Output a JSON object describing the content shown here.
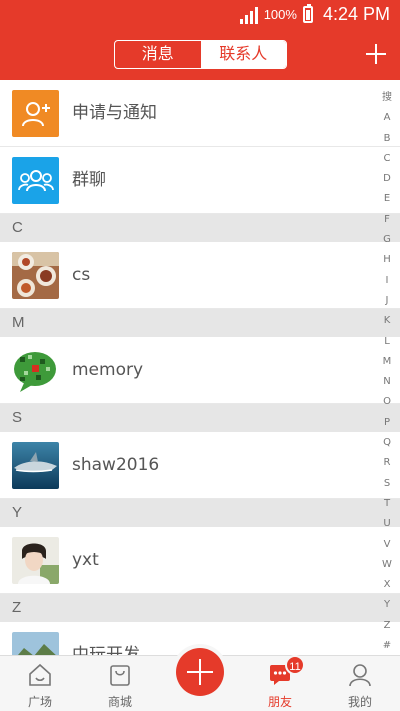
{
  "status_bar": {
    "battery_percent": "100%",
    "time": "4:24 PM"
  },
  "header": {
    "tabs": [
      {
        "label": "消息",
        "active": false
      },
      {
        "label": "联系人",
        "active": true
      }
    ],
    "add_icon": "plus-icon"
  },
  "contacts": {
    "special": [
      {
        "label": "申请与通知",
        "icon": "add-user-icon",
        "color": "#f08a24"
      },
      {
        "label": "群聊",
        "icon": "group-icon",
        "color": "#1aa3e8"
      }
    ],
    "sections": [
      {
        "letter": "C",
        "items": [
          {
            "name": "cs"
          }
        ]
      },
      {
        "letter": "M",
        "items": [
          {
            "name": "memory"
          }
        ]
      },
      {
        "letter": "S",
        "items": [
          {
            "name": "shaw2016"
          }
        ]
      },
      {
        "letter": "Y",
        "items": [
          {
            "name": "yxt"
          }
        ]
      },
      {
        "letter": "Z",
        "items": [
          {
            "name": "中玩开发"
          }
        ]
      }
    ]
  },
  "index_bar": [
    "搜",
    "A",
    "B",
    "C",
    "D",
    "E",
    "F",
    "G",
    "H",
    "I",
    "J",
    "K",
    "L",
    "M",
    "N",
    "O",
    "P",
    "Q",
    "R",
    "S",
    "T",
    "U",
    "V",
    "W",
    "X",
    "Y",
    "Z",
    "#"
  ],
  "tab_bar": {
    "items": [
      {
        "label": "广场",
        "icon": "home-icon"
      },
      {
        "label": "商城",
        "icon": "shop-icon"
      },
      {
        "label": "",
        "icon": "plus-icon"
      },
      {
        "label": "朋友",
        "icon": "chat-icon",
        "badge": "11",
        "active": true
      },
      {
        "label": "我的",
        "icon": "person-icon"
      }
    ]
  },
  "colors": {
    "accent": "#e53a2a",
    "orange": "#f08a24",
    "blue": "#1aa3e8"
  }
}
